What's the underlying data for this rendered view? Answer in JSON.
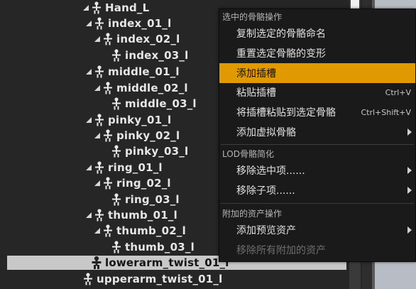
{
  "tree": {
    "rows": [
      {
        "label": "Hand_L",
        "level": 0
      },
      {
        "label": "index_01_l",
        "level": 1
      },
      {
        "label": "index_02_l",
        "level": 2
      },
      {
        "label": "index_03_l",
        "level": 3
      },
      {
        "label": "middle_01_l",
        "level": 1
      },
      {
        "label": "middle_02_l",
        "level": 2
      },
      {
        "label": "middle_03_l",
        "level": 3
      },
      {
        "label": "pinky_01_l",
        "level": 1
      },
      {
        "label": "pinky_02_l",
        "level": 2
      },
      {
        "label": "pinky_03_l",
        "level": 3
      },
      {
        "label": "ring_01_l",
        "level": 1
      },
      {
        "label": "ring_02_l",
        "level": 2
      },
      {
        "label": "ring_03_l",
        "level": 3
      },
      {
        "label": "thumb_01_l",
        "level": 1
      },
      {
        "label": "thumb_02_l",
        "level": 2
      },
      {
        "label": "thumb_03_l",
        "level": 3
      },
      {
        "label": "lowerarm_twist_01_l",
        "level": 0,
        "selected": true
      },
      {
        "label": "upperarm_twist_01_l",
        "level": -1
      }
    ]
  },
  "menu": {
    "section_selected": "选中的骨骼操作",
    "copy_names": "复制选定的骨骼命名",
    "reset_transforms": "重置选定骨骼的变形",
    "add_socket": "添加插槽",
    "paste_socket": "粘贴插槽",
    "paste_socket_shortcut": "Ctrl+V",
    "paste_to_selected": "将插槽粘贴到选定骨骼",
    "paste_to_selected_shortcut": "Ctrl+Shift+V",
    "add_virtual_bone": "添加虚拟骨骼",
    "section_lod": "LOD骨骼简化",
    "remove_selected": "移除选中项......",
    "remove_children": "移除子项......",
    "section_assets": "附加的资产操作",
    "add_preview_asset": "添加预览资产",
    "remove_all_assets": "移除所有附加的资产"
  },
  "colors": {
    "menu_highlight": "#e09a00",
    "selection": "#c8c8c8"
  }
}
